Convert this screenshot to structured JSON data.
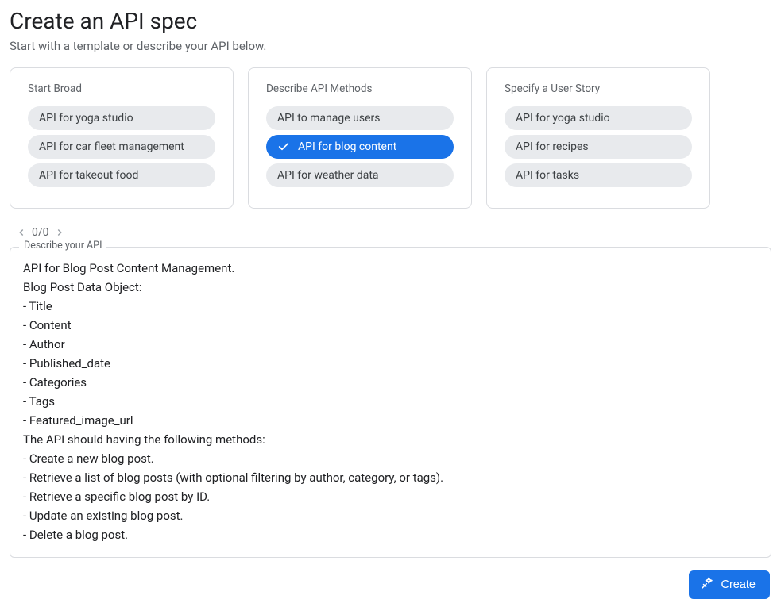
{
  "header": {
    "title": "Create an API spec",
    "subtitle": "Start with a template or describe your API below."
  },
  "cards": [
    {
      "title": "Start Broad",
      "chips": [
        {
          "label": "API for yoga studio",
          "selected": false
        },
        {
          "label": "API for car fleet management",
          "selected": false
        },
        {
          "label": "API for takeout food",
          "selected": false
        }
      ]
    },
    {
      "title": "Describe API Methods",
      "chips": [
        {
          "label": "API to manage users",
          "selected": false
        },
        {
          "label": "API for blog content",
          "selected": true
        },
        {
          "label": "API for weather data",
          "selected": false
        }
      ]
    },
    {
      "title": "Specify a User Story",
      "chips": [
        {
          "label": "API for yoga studio",
          "selected": false
        },
        {
          "label": "API for recipes",
          "selected": false
        },
        {
          "label": "API for tasks",
          "selected": false
        }
      ]
    }
  ],
  "pager": {
    "text": "0/0"
  },
  "describe": {
    "label": "Describe your API",
    "value": "API for Blog Post Content Management.\nBlog Post Data Object:\n- Title\n- Content\n- Author\n- Published_date\n- Categories\n- Tags\n- Featured_image_url\nThe API should having the following methods:\n- Create a new blog post.\n- Retrieve a list of blog posts (with optional filtering by author, category, or tags).\n- Retrieve a specific blog post by ID.\n- Update an existing blog post.\n- Delete a blog post."
  },
  "actions": {
    "create_label": "Create"
  },
  "colors": {
    "accent": "#1a73e8",
    "chip_bg": "#e8eaed",
    "border": "#dadce0",
    "muted": "#5f6368"
  }
}
